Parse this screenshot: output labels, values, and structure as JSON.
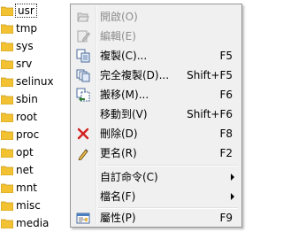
{
  "tree": {
    "folders": [
      "usr",
      "tmp",
      "sys",
      "srv",
      "selinux",
      "sbin",
      "root",
      "proc",
      "opt",
      "net",
      "mnt",
      "misc",
      "media"
    ],
    "selected_index": 0,
    "folder_color": "#f2c233"
  },
  "menu": {
    "items": [
      {
        "label": "開啟(O)",
        "shortcut": "",
        "icon": "open-icon",
        "disabled": true
      },
      {
        "label": "編輯(E)",
        "shortcut": "",
        "icon": "edit-icon",
        "disabled": true
      },
      {
        "label": "複製(C)...",
        "shortcut": "F5",
        "icon": "copy-icon",
        "disabled": false
      },
      {
        "label": "完全複製(D)...",
        "shortcut": "Shift+F5",
        "icon": "full-copy-icon",
        "disabled": false
      },
      {
        "label": "搬移(M)...",
        "shortcut": "F6",
        "icon": "move-icon",
        "disabled": false
      },
      {
        "label": "移動到(V)",
        "shortcut": "Shift+F6",
        "icon": "",
        "disabled": false
      },
      {
        "label": "刪除(D)",
        "shortcut": "F8",
        "icon": "delete-icon",
        "disabled": false
      },
      {
        "label": "更名(R)",
        "shortcut": "F2",
        "icon": "rename-icon",
        "disabled": false
      },
      {
        "label": "自訂命令(C)",
        "shortcut": "",
        "icon": "",
        "disabled": false,
        "submenu": true
      },
      {
        "label": "檔名(F)",
        "shortcut": "",
        "icon": "",
        "disabled": false,
        "submenu": true
      },
      {
        "label": "屬性(P)",
        "shortcut": "F9",
        "icon": "properties-icon",
        "disabled": false
      }
    ]
  }
}
